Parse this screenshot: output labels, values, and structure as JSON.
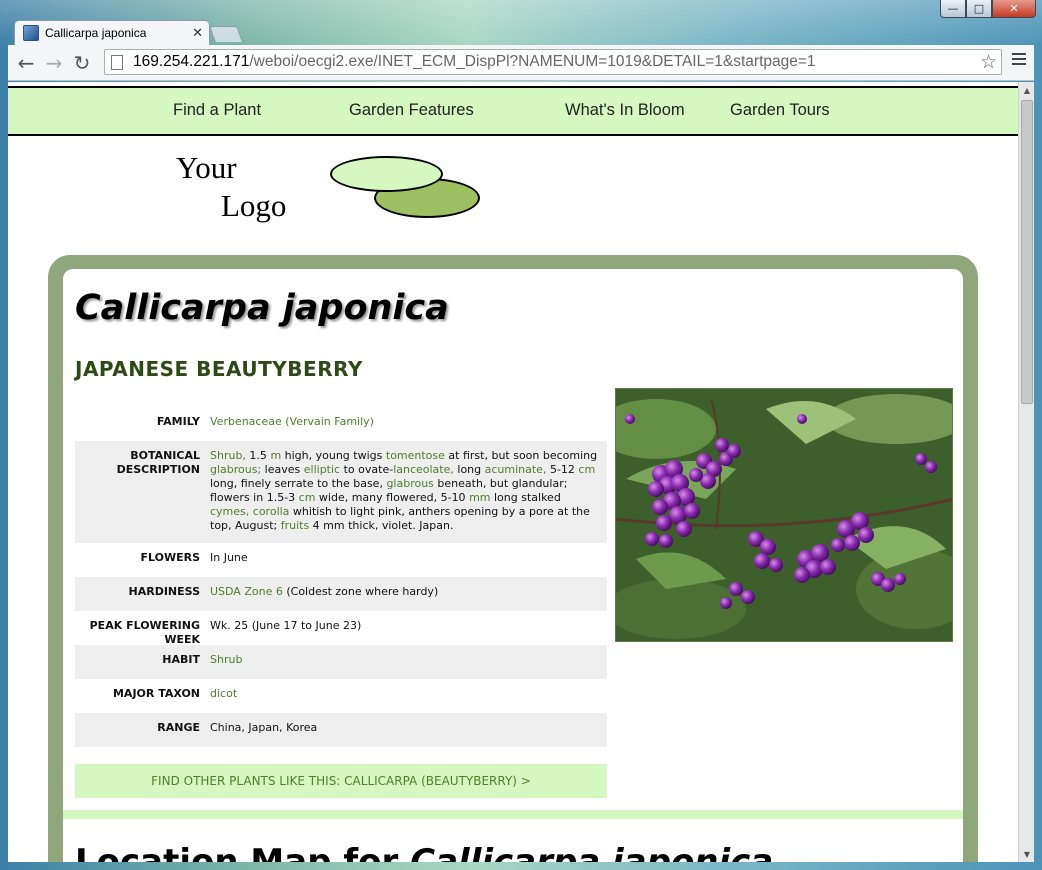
{
  "browser": {
    "tab_title": "Callicarpa japonica",
    "url_host": "169.254.221.171",
    "url_path": "/weboi/oecgi2.exe/INET_ECM_DispPl?NAMENUM=1019&DETAIL=1&startpage=1"
  },
  "nav": {
    "find": "Find a Plant",
    "features": "Garden Features",
    "bloom": "What's In Bloom",
    "tours": "Garden Tours"
  },
  "logo": {
    "line1": "Your",
    "line2": "Logo"
  },
  "plant": {
    "scientific_name": "Callicarpa japonica",
    "common_name": "JAPANESE BEAUTYBERRY"
  },
  "facts": {
    "family_label": "FAMILY",
    "family_value": "Verbenaceae (Vervain Family)",
    "desc_label": "BOTANICAL DESCRIPTION",
    "desc_parts": {
      "p1": "Shrub,",
      "p2": " 1.5 ",
      "p3": "m",
      "p4": " high, young twigs ",
      "p5": "tomentose",
      "p6": " at first, but soon becoming ",
      "p7": "glabrous;",
      "p8": " leaves ",
      "p9": "elliptic",
      "p10": " to ovate-",
      "p11": "lanceolate,",
      "p12": " long ",
      "p13": "acuminate,",
      "p14": " 5-12 ",
      "p15": "cm",
      "p16": " long, finely serrate to the base, ",
      "p17": "glabrous",
      "p18": " beneath, but glandular; flowers in 1.5-3 ",
      "p19": "cm",
      "p20": " wide, many flowered, 5-10 ",
      "p21": "mm",
      "p22": " long stalked ",
      "p23": "cymes,",
      "p24": " ",
      "p25": "corolla",
      "p26": " whitish to light pink, anthers opening by a pore at the top, August; ",
      "p27": "fruits",
      "p28": " 4 mm thick, violet. Japan."
    },
    "flowers_label": "FLOWERS",
    "flowers_value": "In June",
    "hardiness_label": "HARDINESS",
    "hardiness_link": "USDA Zone 6",
    "hardiness_note": " (Coldest zone where hardy)",
    "peak_label": "PEAK FLOWERING WEEK",
    "peak_value": "Wk. 25 (June 17 to June 23)",
    "habit_label": "HABIT",
    "habit_value": "Shrub",
    "taxon_label": "MAJOR TAXON",
    "taxon_value": "dicot",
    "range_label": "RANGE",
    "range_value": "China, Japan, Korea"
  },
  "find_other": "FIND OTHER PLANTS LIKE THIS: CALLICARPA (BEAUTYBERRY) >",
  "location": {
    "prefix": "Location Map for ",
    "name": "Callicarpa japonica"
  },
  "colors": {
    "nav_bg": "#d4f8bf",
    "frame": "#8fa77b",
    "link_green": "#4f7e2c",
    "heading_green": "#2e4a14"
  }
}
